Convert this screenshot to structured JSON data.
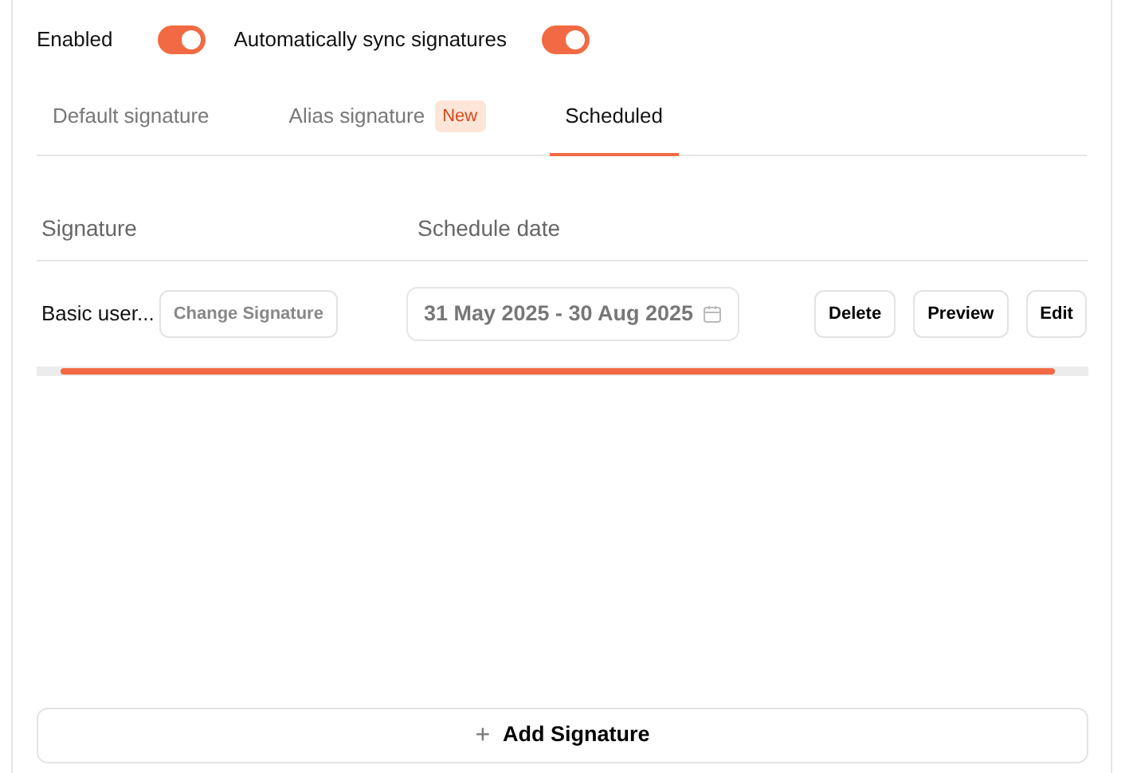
{
  "toggles": [
    {
      "label": "Enabled",
      "on": true
    },
    {
      "label": "Automatically sync signatures",
      "on": true
    }
  ],
  "tabs": [
    {
      "label": "Default signature",
      "selected": false
    },
    {
      "label": "Alias signature",
      "badge": "New",
      "selected": false
    },
    {
      "label": "Scheduled",
      "selected": true
    }
  ],
  "table": {
    "columns": [
      "Signature",
      "Schedule date"
    ],
    "rows": [
      {
        "signature": "Basic user...",
        "change_button": "Change Signature",
        "date_range": "31 May 2025 - 30 Aug 2025",
        "actions": [
          "Delete",
          "Preview",
          "Edit"
        ]
      }
    ]
  },
  "add_button": {
    "icon": "+",
    "label": "Add Signature"
  }
}
